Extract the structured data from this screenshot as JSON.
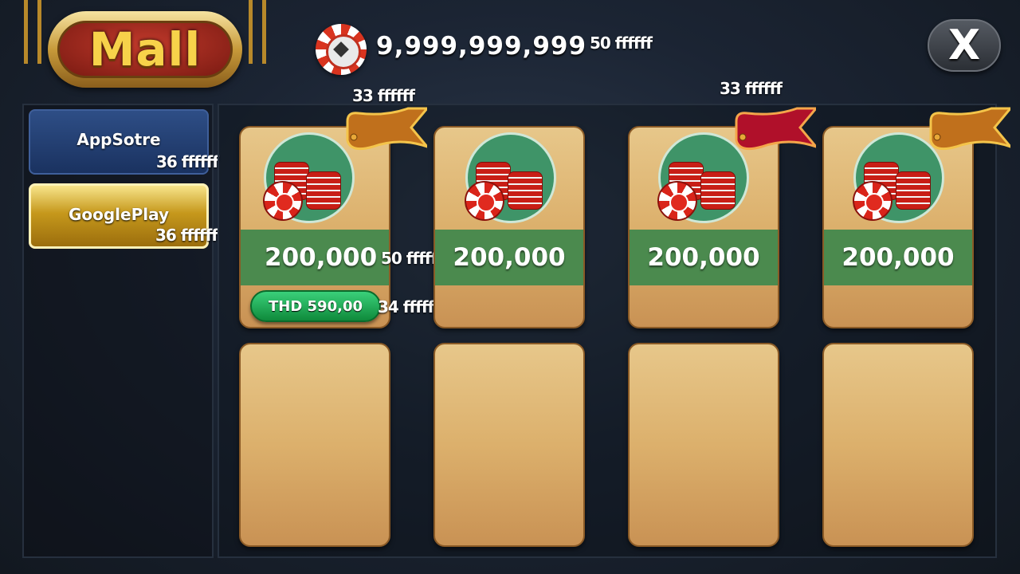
{
  "header": {
    "title": "Mall",
    "balance": "9,999,999,999",
    "balance_debug": "50 ffffff",
    "close_label": "X"
  },
  "debug_labels": {
    "ribbon_left": "33  ffffff",
    "ribbon_right": "33  ffffff"
  },
  "sidebar": {
    "tabs": [
      {
        "label": "AppSotre",
        "debug": "36  ffffff"
      },
      {
        "label": "GooglePlay",
        "debug": "36  ffffff"
      }
    ]
  },
  "products": [
    {
      "amount": "200,000",
      "amount_debug": "50 ffffff",
      "price": "THD 590,00",
      "price_debug": "34 ffffff",
      "ribbon_color": "#c0701c"
    },
    {
      "amount": "200,000"
    },
    {
      "amount": "200,000",
      "ribbon_color": "#b0102a"
    },
    {
      "amount": "200,000",
      "ribbon_color": "#c0701c"
    }
  ],
  "colors": {
    "band_green": "#4b8a4e",
    "price_green": "#18a24e",
    "ribbon_orange": "#c0701c",
    "ribbon_red": "#b0102a",
    "title_gold": "#f7d24a"
  },
  "icons": [
    "chip-coin-icon",
    "close-icon",
    "chip-stack-icon",
    "ribbon-icon"
  ]
}
